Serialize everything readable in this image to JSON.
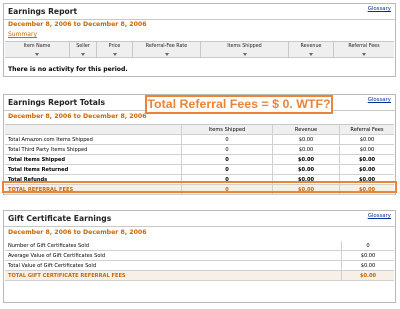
{
  "colors": {
    "accent": "#cc6600",
    "annotation": "#e9853b",
    "link": "#003399"
  },
  "earnings": {
    "title": "Earnings Report",
    "glossary": "Glossary",
    "date_range": "December 8, 2006 to December 8, 2006",
    "summary_link": "Summary",
    "columns": [
      "Item Name",
      "Seller",
      "Price",
      "Referral-Fee Rate",
      "Items Shipped",
      "Revenue",
      "Referral Fees"
    ],
    "no_activity": "There is no activity for this period."
  },
  "totals": {
    "title": "Earnings Report Totals",
    "glossary": "Glossary",
    "date_range": "December 8, 2006 to December 8, 2006",
    "headers": [
      "",
      "Items Shipped",
      "Revenue",
      "Referral Fees"
    ],
    "rows": [
      {
        "label": "Total Amazon.com Items Shipped",
        "shipped": "0",
        "revenue": "$0.00",
        "fees": "$0.00"
      },
      {
        "label": "Total Third Party Items Shipped",
        "shipped": "0",
        "revenue": "$0.00",
        "fees": "$0.00"
      },
      {
        "label": "Total Items Shipped",
        "shipped": "0",
        "revenue": "$0.00",
        "fees": "$0.00"
      },
      {
        "label": "Total Items Returned",
        "shipped": "0",
        "revenue": "$0.00",
        "fees": "$0.00"
      },
      {
        "label": "Total Refunds",
        "shipped": "0",
        "revenue": "$0.00",
        "fees": "$0.00"
      },
      {
        "label": "TOTAL REFERRAL FEES",
        "shipped": "0",
        "revenue": "$0.00",
        "fees": "$0.00"
      }
    ]
  },
  "annotation": {
    "text": "Total Referral Fees = $  0. WTF?"
  },
  "gift": {
    "title": "Gift Certificate Earnings",
    "glossary": "Glossary",
    "date_range": "December 8, 2006 to December 8, 2006",
    "rows": [
      {
        "label": "Number of Gift Certificates Sold",
        "value": "0"
      },
      {
        "label": "Average Value of Gift Certificates Sold",
        "value": "$0.00"
      },
      {
        "label": "Total Value of Gift Certificates Sold",
        "value": "$0.00"
      },
      {
        "label": "TOTAL GIFT CERTIFICATE REFERRAL FEES",
        "value": "$0.00"
      }
    ]
  }
}
